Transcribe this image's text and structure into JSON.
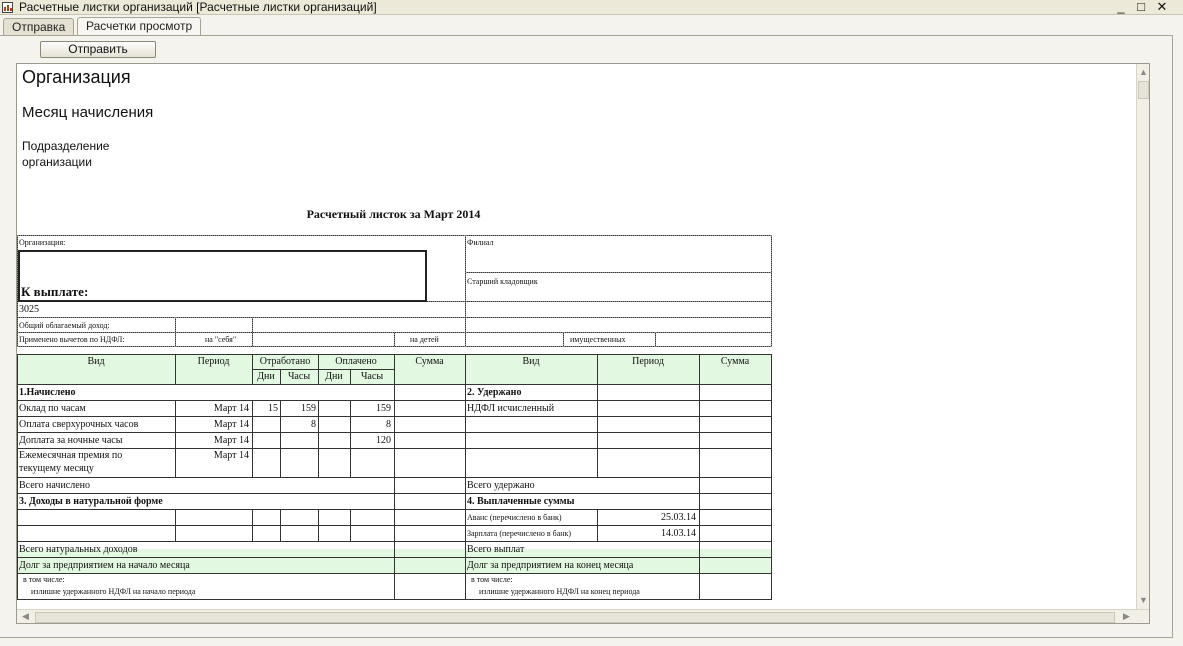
{
  "window": {
    "title": "Расчетные листки организаций [Расчетные листки организаций]",
    "minimize_glyph": "_",
    "maximize_glyph": "□",
    "close_glyph": "✕"
  },
  "tabs": [
    {
      "label": "Отправка",
      "active": false
    },
    {
      "label": "Расчетки просмотр",
      "active": true
    }
  ],
  "toolbar": {
    "send_label": "Отправить"
  },
  "report": {
    "org_heading": "Организация",
    "month_heading": "Месяц начисления",
    "dept_heading_1": "Подразделение",
    "dept_heading_2": "организации",
    "title": "Расчетный листок за Март 2014"
  },
  "slip": {
    "org_label": "Организация:",
    "branch": "Филиал",
    "position": "Старший кладовщик",
    "pay_label": "К выплате:",
    "code": "3025",
    "taxable_label": "Общий облагаемый доход:",
    "deductions_label": "Применено вычетов по НДФЛ:",
    "self_label": "на \"себя\"",
    "children_label": "на детей",
    "property_label": "имущественных",
    "headers": {
      "kind": "Вид",
      "period": "Период",
      "worked": "Отработано",
      "paid": "Оплачено",
      "days": "Дни",
      "hours": "Часы",
      "sum": "Сумма"
    },
    "accrued": {
      "title": "1.Начислено",
      "rows": [
        {
          "name": "Оклад по часам",
          "period": "Март 14",
          "worked_days": "15",
          "worked_hours": "159",
          "paid_days": "",
          "paid_hours": "159",
          "sum": ""
        },
        {
          "name": "Оплата сверхурочных часов",
          "period": "Март 14",
          "worked_days": "",
          "worked_hours": "8",
          "paid_days": "",
          "paid_hours": "8",
          "sum": ""
        },
        {
          "name": "Доплата за ночные часы",
          "period": "Март 14",
          "worked_days": "",
          "worked_hours": "",
          "paid_days": "",
          "paid_hours": "120",
          "sum": ""
        },
        {
          "name_1": "Ежемесячная премия по",
          "name_2": "текущему месяцу",
          "period": "Март 14"
        }
      ],
      "total_label": "Всего начислено"
    },
    "withheld": {
      "title": "2. Удержано",
      "rows": [
        {
          "name": "НДФЛ исчисленный"
        }
      ],
      "total_label": "Всего удержано"
    },
    "in_kind": {
      "title": "3. Доходы в натуральной форме",
      "total_label": "Всего натуральных доходов"
    },
    "paid_out": {
      "title": "4. Выплаченные суммы",
      "rows": [
        {
          "name": "Аванс (перечислено в банк)",
          "date": "25.03.14"
        },
        {
          "name": "Зарплата (перечислено в банк)",
          "date": "14.03.14"
        }
      ],
      "total_label": "Всего выплат"
    },
    "debt_start_label": "Долг за предприятием на начало месяца",
    "debt_end_label": "Долг за предприятием на конец месяца",
    "including_label": "в том числе:",
    "excess_start_label": "излишне удержанного НДФЛ на начало периода",
    "excess_end_label": "излишне удержанного НДФЛ на конец периода"
  }
}
